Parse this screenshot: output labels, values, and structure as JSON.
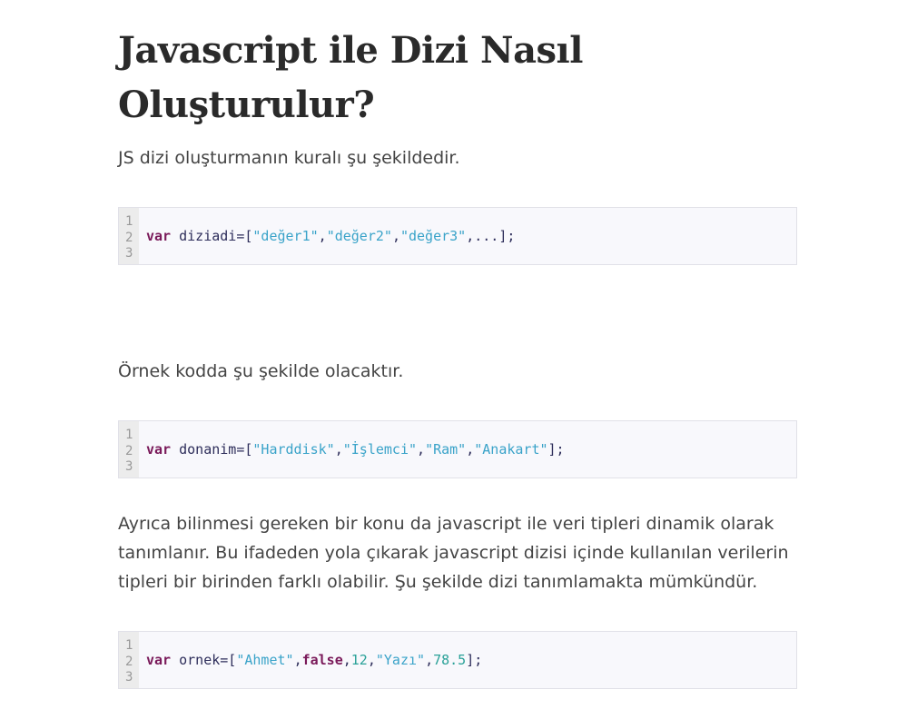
{
  "article": {
    "title": "Javascript ile Dizi Nasıl Oluşturulur?",
    "para1": "JS dizi oluşturmanın kuralı şu şekildedir.",
    "para2": "Örnek kodda şu şekilde olacaktır.",
    "para3": "Ayrıca bilinmesi gereken bir konu da javascript ile veri tipleri dinamik olarak tanımlanır. Bu ifadeden yola çıkarak javascript dizisi içinde kullanılan verilerin tipleri bir birinden farklı olabilir. Şu şekilde dizi tanımlamakta mümkündür."
  },
  "line_numbers": [
    "1",
    "2",
    "3"
  ],
  "code1": {
    "keyword": "var",
    "ident": " diziadi=[",
    "s1": "\"değer1\"",
    "c1": ",",
    "s2": "\"değer2\"",
    "c2": ",",
    "s3": "\"değer3\"",
    "rest": ",...];"
  },
  "code2": {
    "keyword": "var",
    "ident": " donanim=[",
    "s1": "\"Harddisk\"",
    "c1": ",",
    "s2": "\"İşlemci\"",
    "c2": ",",
    "s3": "\"Ram\"",
    "c3": ",",
    "s4": "\"Anakart\"",
    "rest": "];"
  },
  "code3": {
    "keyword": "var",
    "ident": " ornek=[",
    "s1": "\"Ahmet\"",
    "c1": ",",
    "kw2": "false",
    "c2": ",",
    "n1": "12",
    "c3": ",",
    "s2": "\"Yazı\"",
    "c4": ",",
    "n2": "78.5",
    "rest": "];"
  }
}
